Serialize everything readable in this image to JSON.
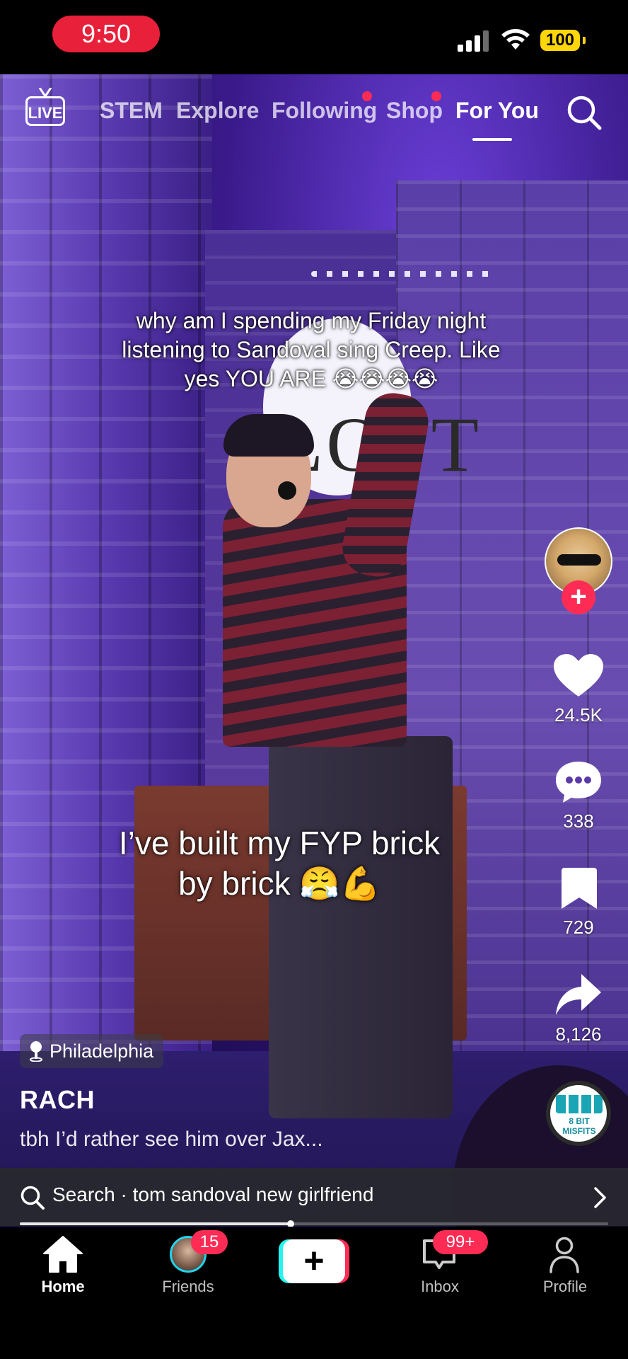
{
  "status_bar": {
    "time": "9:50",
    "battery": "100"
  },
  "top_nav": {
    "live_label": "LIVE",
    "tabs": [
      {
        "label": "STEM",
        "active": false,
        "dot": false
      },
      {
        "label": "Explore",
        "active": false,
        "dot": false
      },
      {
        "label": "Following",
        "active": false,
        "dot": true
      },
      {
        "label": "Shop",
        "active": false,
        "dot": true
      },
      {
        "label": "For You",
        "active": true,
        "dot": false
      }
    ],
    "search_icon": "search-icon"
  },
  "video": {
    "sign_text": "LOFT",
    "caption_top": "why am I spending my Friday night listening to Sandoval sing Creep. Like yes YOU ARE 😭😭😭😭",
    "caption_mid": "I’ve built my FYP brick by brick 😤💪"
  },
  "right_rail": {
    "like_count": "24.5K",
    "comment_count": "338",
    "save_count": "729",
    "share_count": "8,126",
    "music_disc_text": "8 BIT MISFITS"
  },
  "post": {
    "location": "Philadelphia",
    "username": "RACH",
    "description": "tbh I’d rather see him over Jax..."
  },
  "search_bar": {
    "text": "Search · tom sandoval new girlfriend"
  },
  "playback": {
    "progress": 0.46
  },
  "tab_bar": {
    "home": "Home",
    "friends": "Friends",
    "friends_badge": "15",
    "create": "+",
    "inbox": "Inbox",
    "inbox_badge": "99+",
    "profile": "Profile"
  },
  "colors": {
    "accent_red": "#fe2c55",
    "accent_cyan": "#25f4ee",
    "battery_yellow": "#ffd60a",
    "time_pill": "#e8203a"
  }
}
